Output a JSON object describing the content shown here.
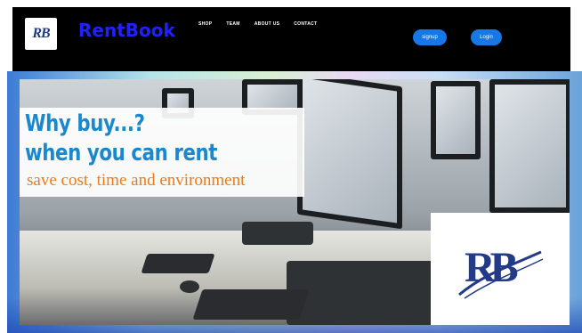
{
  "header": {
    "logo_text": "RB",
    "brand": "RentBook",
    "nav": [
      "SHOP",
      "TEAM",
      "ABOUT US",
      "CONTACT"
    ],
    "signup_label": "signup",
    "login_label": "Login"
  },
  "hero": {
    "line1": "Why buy...?",
    "line2": "when you can rent",
    "line3": "save cost, time and environment",
    "badge_text": "RB"
  },
  "colors": {
    "brand": "#1e22ff",
    "nav_bg": "#000000",
    "button": "#1777e6",
    "tagline_blue": "#1a88cf",
    "tagline_orange": "#f07a18"
  }
}
